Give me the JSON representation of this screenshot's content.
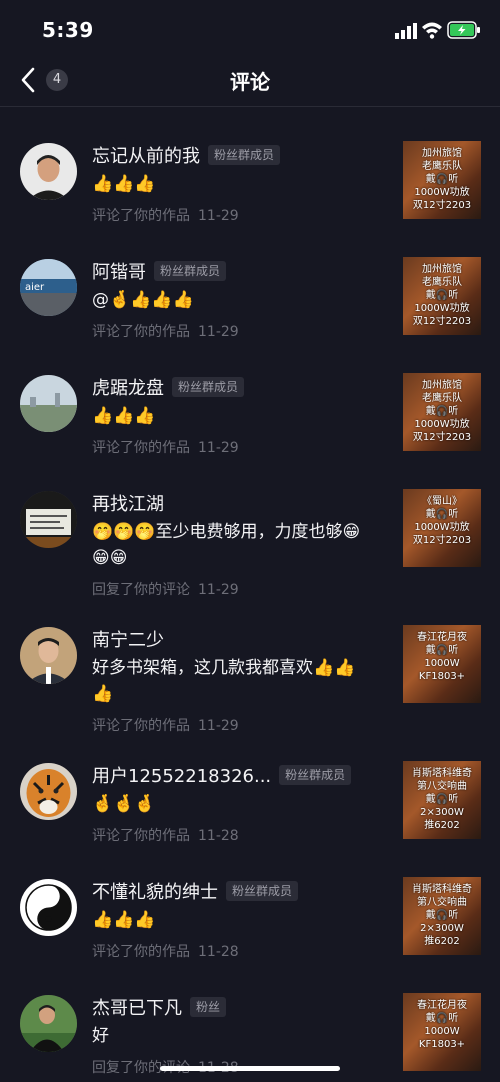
{
  "status": {
    "time": "5:39"
  },
  "nav": {
    "title": "评论",
    "badge": "4"
  },
  "comments": [
    {
      "name": "忘记从前的我",
      "badge": "粉丝群成员",
      "text": "👍👍👍",
      "action": "评论了你的作品",
      "date": "11-29",
      "thumb": [
        "加州旅馆",
        "老鹰乐队",
        "戴🎧听",
        "1000W功放",
        "双12寸2203"
      ]
    },
    {
      "name": "阿锴哥",
      "badge": "粉丝群成员",
      "text": "@🤞👍👍👍",
      "action": "评论了你的作品",
      "date": "11-29",
      "thumb": [
        "加州旅馆",
        "老鹰乐队",
        "戴🎧听",
        "1000W功放",
        "双12寸2203"
      ]
    },
    {
      "name": "虎踞龙盘",
      "badge": "粉丝群成员",
      "text": "👍👍👍",
      "action": "评论了你的作品",
      "date": "11-29",
      "thumb": [
        "加州旅馆",
        "老鹰乐队",
        "戴🎧听",
        "1000W功放",
        "双12寸2203"
      ]
    },
    {
      "name": "再找江湖",
      "badge": "",
      "text": "🤭🤭🤭至少电费够用，力度也够😁😁😁",
      "action": "回复了你的评论",
      "date": "11-29",
      "thumb": [
        "《蜀山》",
        "戴🎧听",
        "1000W功放",
        "双12寸2203"
      ]
    },
    {
      "name": "南宁二少",
      "badge": "",
      "text": "好多书架箱，这几款我都喜欢👍👍👍",
      "action": "评论了你的作品",
      "date": "11-29",
      "thumb": [
        "春江花月夜",
        "戴🎧听",
        "1000W",
        "KF1803+"
      ]
    },
    {
      "name": "用户12552218326...",
      "badge": "粉丝群成员",
      "text": "🤞🤞🤞",
      "action": "评论了你的作品",
      "date": "11-28",
      "thumb": [
        "肖斯塔科维奇",
        "第八交响曲",
        "戴🎧听",
        "2×300W",
        "推6202"
      ]
    },
    {
      "name": "不懂礼貌的绅士",
      "badge": "粉丝群成员",
      "text": "👍👍👍",
      "action": "评论了你的作品",
      "date": "11-28",
      "thumb": [
        "肖斯塔科维奇",
        "第八交响曲",
        "戴🎧听",
        "2×300W",
        "推6202"
      ]
    },
    {
      "name": "杰哥已下凡",
      "badge": "粉丝",
      "text": "好",
      "action": "回复了你的评论",
      "date": "11-28",
      "thumb": [
        "春江花月夜",
        "戴🎧听",
        "1000W",
        "KF1803+"
      ]
    }
  ]
}
